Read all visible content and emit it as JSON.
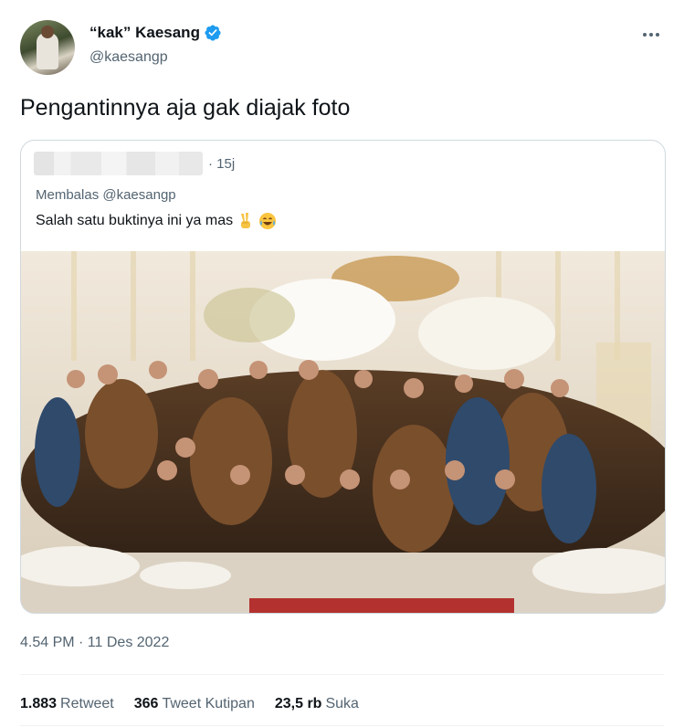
{
  "author": {
    "display_name": "“kak” Kaesang",
    "handle": "@kaesangp",
    "verified_icon": "verified-badge-icon",
    "accent_color": "#1d9bf0"
  },
  "tweet": {
    "text": "Pengantinnya aja gak diajak foto",
    "timestamp": "4.54 PM · 11 Des 2022"
  },
  "quoted_tweet": {
    "time": "· 15j",
    "reply_to": "Membalas @kaesangp",
    "text": "Salah satu buktinya ini ya mas",
    "emojis": [
      "victory-hand-emoji",
      "tears-of-joy-emoji"
    ]
  },
  "stats": [
    {
      "value": "1.883",
      "label": "Retweet"
    },
    {
      "value": "366",
      "label": "Tweet Kutipan"
    },
    {
      "value": "23,5 rb",
      "label": "Suka"
    }
  ]
}
